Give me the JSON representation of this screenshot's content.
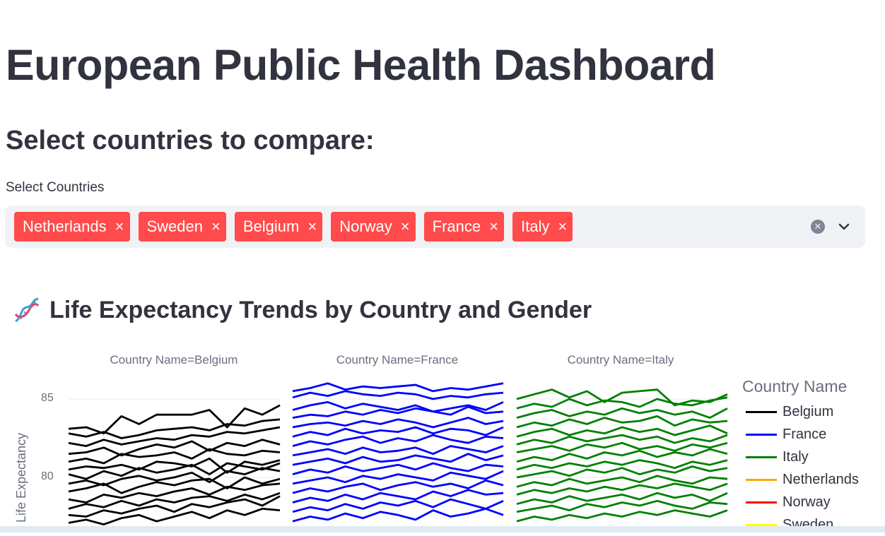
{
  "title": "European Public Health Dashboard",
  "subheader": "Select countries to compare:",
  "select": {
    "label": "Select Countries",
    "chips": [
      "Netherlands",
      "Sweden",
      "Belgium",
      "Norway",
      "France",
      "Italy"
    ],
    "remove_glyph": "×"
  },
  "icons": {
    "chip_remove": "close-icon",
    "clear": "clear-circle-icon",
    "dropdown": "chevron-down-icon",
    "chart": "dna-icon"
  },
  "chart_section": {
    "title": "Life Expectancy Trends by Country and Gender"
  },
  "chart_data": {
    "type": "line",
    "facet_labels": [
      "Country Name=Belgium",
      "Country Name=France",
      "Country Name=Italy"
    ],
    "ylabel": "Life Expectancy",
    "y_ticks": [
      "85",
      "80"
    ],
    "ylim": [
      76.5,
      86.5
    ],
    "x_points": 12,
    "legend_title": "Country Name",
    "legend": [
      {
        "name": "Belgium",
        "color": "#000000"
      },
      {
        "name": "France",
        "color": "#0000ff"
      },
      {
        "name": "Italy",
        "color": "#008000"
      },
      {
        "name": "Netherlands",
        "color": "#ffa500"
      },
      {
        "name": "Norway",
        "color": "#ff0000"
      },
      {
        "name": "Sweden",
        "color": "#ffff00"
      }
    ],
    "series": [
      {
        "name": "Belgium",
        "color": "#000000",
        "lines": [
          [
            83.1,
            83.2,
            82.8,
            83.9,
            83.4,
            84.0,
            84.0,
            84.0,
            84.3,
            83.2,
            84.4,
            84.0,
            84.6
          ],
          [
            82.8,
            82.6,
            82.9,
            82.5,
            82.7,
            83.0,
            83.1,
            83.2,
            83.0,
            83.4,
            83.3,
            83.6,
            83.7
          ],
          [
            82.2,
            82.0,
            82.4,
            82.1,
            82.3,
            82.5,
            82.4,
            82.7,
            82.6,
            82.9,
            82.8,
            83.0,
            83.2
          ],
          [
            81.5,
            81.6,
            81.9,
            81.4,
            81.8,
            82.1,
            81.9,
            82.3,
            81.7,
            82.2,
            82.0,
            82.4,
            82.1
          ],
          [
            81.0,
            81.2,
            80.9,
            81.5,
            81.3,
            81.4,
            81.6,
            81.2,
            81.8,
            81.5,
            81.4,
            81.7,
            81.6
          ],
          [
            80.5,
            80.7,
            80.6,
            80.8,
            80.5,
            81.0,
            80.9,
            80.7,
            81.2,
            80.3,
            81.0,
            80.8,
            81.1
          ],
          [
            80.2,
            79.9,
            80.4,
            80.1,
            80.6,
            80.3,
            80.5,
            80.8,
            80.2,
            80.9,
            80.7,
            80.5,
            80.9
          ],
          [
            79.6,
            79.8,
            79.5,
            79.9,
            80.1,
            79.8,
            80.0,
            80.3,
            79.7,
            80.4,
            80.2,
            80.6,
            80.4
          ],
          [
            79.1,
            79.3,
            79.6,
            79.0,
            79.4,
            79.7,
            79.5,
            79.8,
            79.9,
            79.3,
            80.0,
            79.6,
            79.9
          ],
          [
            78.6,
            78.4,
            78.9,
            78.7,
            79.0,
            78.8,
            79.1,
            79.3,
            78.9,
            79.4,
            79.2,
            79.5,
            79.6
          ],
          [
            78.0,
            78.3,
            78.1,
            78.5,
            78.2,
            78.6,
            78.4,
            78.7,
            78.8,
            78.5,
            78.9,
            78.6,
            79.0
          ],
          [
            77.6,
            77.5,
            77.9,
            77.7,
            78.0,
            78.2,
            77.8,
            78.3,
            78.1,
            78.4,
            78.6,
            78.2,
            78.8
          ],
          [
            77.1,
            77.3,
            77.0,
            77.4,
            77.6,
            77.2,
            77.5,
            77.8,
            77.4,
            77.9,
            77.6,
            78.0,
            77.9
          ]
        ]
      },
      {
        "name": "France",
        "color": "#0000ff",
        "lines": [
          [
            85.5,
            85.7,
            86.0,
            85.6,
            85.8,
            85.7,
            85.8,
            85.9,
            85.5,
            85.7,
            85.6,
            85.8,
            86.0
          ],
          [
            85.1,
            85.4,
            85.2,
            85.5,
            85.3,
            85.2,
            85.4,
            85.3,
            85.0,
            85.2,
            85.1,
            85.3,
            85.4
          ],
          [
            84.3,
            84.6,
            84.8,
            84.4,
            84.7,
            84.5,
            84.3,
            84.6,
            84.2,
            84.4,
            84.6,
            84.3,
            84.8
          ],
          [
            83.8,
            84.0,
            83.9,
            84.2,
            84.0,
            84.3,
            84.1,
            84.4,
            84.2,
            84.0,
            84.5,
            84.1,
            84.2
          ],
          [
            83.2,
            83.4,
            83.5,
            83.3,
            83.6,
            83.4,
            83.7,
            83.5,
            83.2,
            83.5,
            83.8,
            83.4,
            83.6
          ],
          [
            82.6,
            82.9,
            82.7,
            83.1,
            82.8,
            83.0,
            82.9,
            83.2,
            82.8,
            83.1,
            83.0,
            82.7,
            83.2
          ],
          [
            82.0,
            82.3,
            82.1,
            82.4,
            82.6,
            82.2,
            82.5,
            82.3,
            82.7,
            82.4,
            82.2,
            82.6,
            82.5
          ],
          [
            81.4,
            81.6,
            81.8,
            81.5,
            81.9,
            81.6,
            81.7,
            81.9,
            81.5,
            82.0,
            81.8,
            81.6,
            82.0
          ],
          [
            80.8,
            81.0,
            81.2,
            80.9,
            81.3,
            81.0,
            81.1,
            81.4,
            81.2,
            81.0,
            81.5,
            81.1,
            81.4
          ],
          [
            80.2,
            80.5,
            80.3,
            80.7,
            80.4,
            80.6,
            80.8,
            80.5,
            80.9,
            80.6,
            80.4,
            80.8,
            80.7
          ],
          [
            79.6,
            79.8,
            80.0,
            79.7,
            80.1,
            79.9,
            80.2,
            80.0,
            79.8,
            80.3,
            80.1,
            79.9,
            80.4
          ],
          [
            79.0,
            79.3,
            79.1,
            79.4,
            79.6,
            79.2,
            79.5,
            79.7,
            79.4,
            79.6,
            79.3,
            79.8,
            79.5
          ],
          [
            78.4,
            78.7,
            78.5,
            78.9,
            78.6,
            79.0,
            78.8,
            78.6,
            79.1,
            78.8,
            79.2,
            78.9,
            79.0
          ],
          [
            77.8,
            78.1,
            77.9,
            78.3,
            78.0,
            78.4,
            78.2,
            78.5,
            78.1,
            78.6,
            78.3,
            78.0,
            78.5
          ],
          [
            77.2,
            77.5,
            77.3,
            77.7,
            77.4,
            77.8,
            77.6,
            77.3,
            77.9,
            77.5,
            77.7,
            78.0,
            77.6
          ]
        ]
      },
      {
        "name": "Italy",
        "color": "#008000",
        "lines": [
          [
            85.0,
            85.3,
            85.6,
            85.1,
            85.5,
            84.8,
            85.4,
            85.5,
            85.6,
            84.6,
            84.9,
            84.8,
            85.3
          ],
          [
            84.4,
            84.7,
            84.5,
            85.0,
            84.6,
            84.9,
            84.8,
            84.5,
            85.0,
            84.7,
            84.6,
            84.9,
            85.1
          ],
          [
            83.8,
            84.1,
            84.3,
            83.9,
            84.2,
            84.0,
            84.4,
            84.1,
            84.3,
            84.0,
            84.2,
            83.8,
            84.4
          ],
          [
            83.2,
            83.5,
            83.3,
            83.7,
            83.4,
            83.8,
            83.5,
            83.6,
            83.9,
            83.3,
            83.7,
            83.5,
            83.6
          ],
          [
            82.6,
            82.9,
            83.1,
            82.7,
            83.0,
            82.8,
            83.2,
            82.9,
            83.1,
            82.7,
            83.0,
            83.3,
            82.8
          ],
          [
            82.1,
            82.4,
            82.2,
            82.6,
            82.3,
            82.5,
            82.7,
            82.4,
            82.6,
            82.2,
            82.5,
            82.3,
            82.7
          ],
          [
            81.6,
            81.8,
            82.0,
            81.7,
            82.1,
            81.9,
            82.2,
            81.8,
            82.0,
            81.7,
            82.1,
            81.9,
            82.2
          ],
          [
            81.0,
            81.3,
            81.1,
            81.5,
            81.2,
            81.6,
            81.4,
            81.7,
            81.3,
            81.6,
            81.4,
            81.8,
            81.5
          ],
          [
            80.5,
            80.8,
            80.6,
            80.9,
            80.7,
            81.0,
            80.8,
            81.1,
            80.9,
            80.6,
            81.0,
            80.8,
            81.1
          ],
          [
            80.0,
            80.2,
            80.4,
            80.1,
            80.5,
            80.3,
            80.6,
            80.2,
            80.5,
            80.3,
            80.7,
            80.4,
            80.6
          ],
          [
            79.4,
            79.7,
            79.5,
            79.9,
            79.6,
            79.8,
            80.0,
            79.7,
            80.1,
            79.8,
            79.6,
            80.0,
            79.9
          ],
          [
            78.9,
            79.2,
            79.0,
            79.3,
            79.1,
            79.4,
            79.2,
            79.5,
            79.3,
            79.6,
            79.4,
            79.2,
            79.6
          ],
          [
            78.3,
            78.6,
            78.4,
            78.8,
            78.5,
            78.7,
            78.9,
            78.6,
            79.0,
            78.7,
            78.9,
            78.5,
            79.0
          ],
          [
            77.8,
            78.0,
            78.2,
            77.9,
            78.3,
            78.1,
            78.4,
            78.2,
            78.5,
            78.2,
            78.0,
            78.4,
            78.3
          ],
          [
            77.2,
            77.5,
            77.3,
            77.6,
            77.4,
            77.7,
            77.5,
            77.8,
            77.6,
            77.9,
            77.7,
            77.5,
            77.9
          ]
        ]
      }
    ]
  }
}
